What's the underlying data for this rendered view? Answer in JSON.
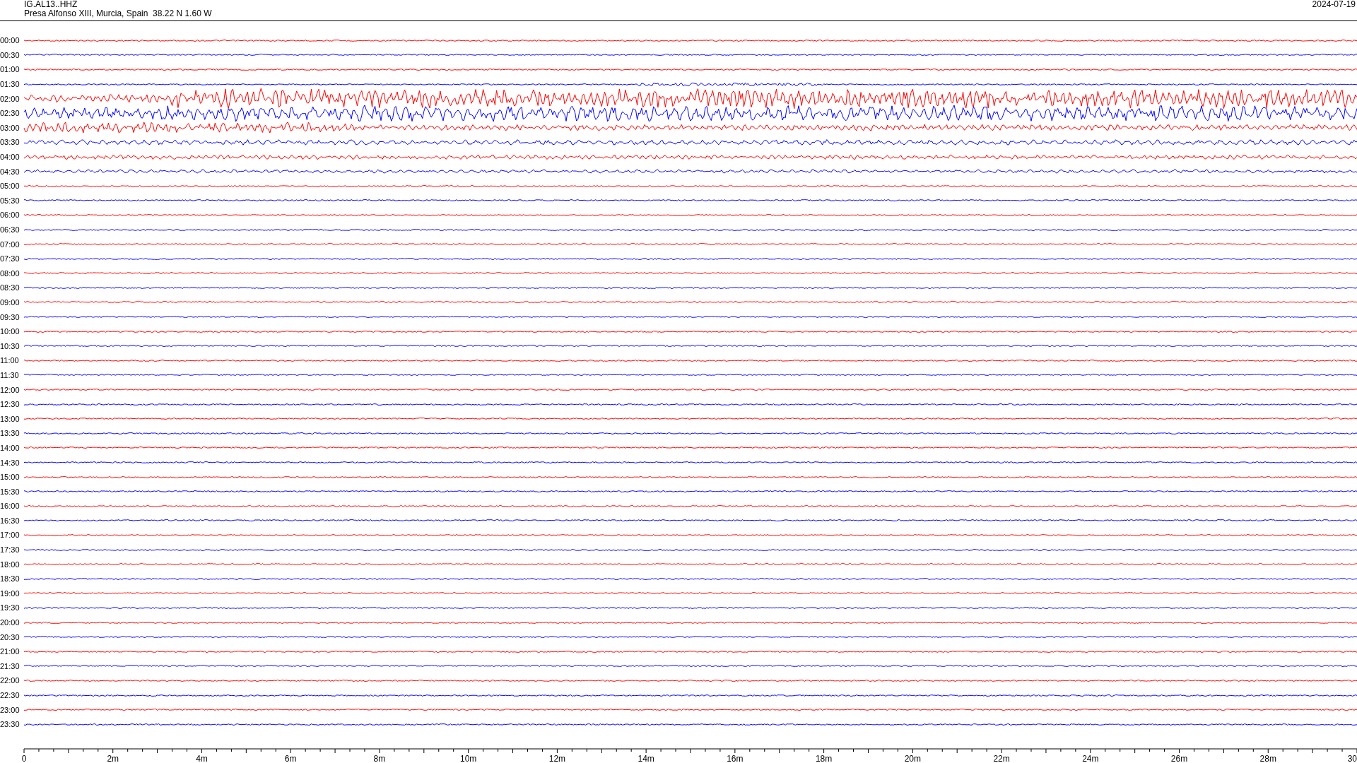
{
  "header": {
    "station": "IG.AL13..HHZ",
    "location": "Presa Alfonso XIII, Murcia, Spain  38.22 N 1.60 W",
    "date": "2024-07-19"
  },
  "traces": [
    {
      "time": "00:00",
      "color": "#ff0000"
    },
    {
      "time": "00:30",
      "color": "#0000ff"
    },
    {
      "time": "01:00",
      "color": "#ff0000"
    },
    {
      "time": "01:30",
      "color": "#0000ff"
    },
    {
      "time": "02:00",
      "color": "#ff0000"
    },
    {
      "time": "02:30",
      "color": "#0000ff"
    },
    {
      "time": "03:00",
      "color": "#ff0000"
    },
    {
      "time": "03:30",
      "color": "#0000ff"
    },
    {
      "time": "04:00",
      "color": "#ff0000"
    },
    {
      "time": "04:30",
      "color": "#0000ff"
    },
    {
      "time": "05:00",
      "color": "#ff0000"
    },
    {
      "time": "05:30",
      "color": "#0000ff"
    },
    {
      "time": "06:00",
      "color": "#ff0000"
    },
    {
      "time": "06:30",
      "color": "#0000ff"
    },
    {
      "time": "07:00",
      "color": "#ff0000"
    },
    {
      "time": "07:30",
      "color": "#0000ff"
    },
    {
      "time": "08:00",
      "color": "#ff0000"
    },
    {
      "time": "08:30",
      "color": "#0000ff"
    },
    {
      "time": "09:00",
      "color": "#ff0000"
    },
    {
      "time": "09:30",
      "color": "#0000ff"
    },
    {
      "time": "10:00",
      "color": "#ff0000"
    },
    {
      "time": "10:30",
      "color": "#0000ff"
    },
    {
      "time": "11:00",
      "color": "#ff0000"
    },
    {
      "time": "11:30",
      "color": "#0000ff"
    },
    {
      "time": "12:00",
      "color": "#ff0000"
    },
    {
      "time": "12:30",
      "color": "#0000ff"
    },
    {
      "time": "13:00",
      "color": "#ff0000"
    },
    {
      "time": "13:30",
      "color": "#0000ff"
    },
    {
      "time": "14:00",
      "color": "#ff0000"
    },
    {
      "time": "14:30",
      "color": "#0000ff"
    },
    {
      "time": "15:00",
      "color": "#ff0000"
    },
    {
      "time": "15:30",
      "color": "#0000ff"
    },
    {
      "time": "16:00",
      "color": "#ff0000"
    },
    {
      "time": "16:30",
      "color": "#0000ff"
    },
    {
      "time": "17:00",
      "color": "#ff0000"
    },
    {
      "time": "17:30",
      "color": "#0000ff"
    },
    {
      "time": "18:00",
      "color": "#ff0000"
    },
    {
      "time": "18:30",
      "color": "#0000ff"
    },
    {
      "time": "19:00",
      "color": "#ff0000"
    },
    {
      "time": "19:30",
      "color": "#0000ff"
    },
    {
      "time": "20:00",
      "color": "#ff0000"
    },
    {
      "time": "20:30",
      "color": "#0000ff"
    },
    {
      "time": "21:00",
      "color": "#ff0000"
    },
    {
      "time": "21:30",
      "color": "#0000ff"
    },
    {
      "time": "22:00",
      "color": "#ff0000"
    },
    {
      "time": "22:30",
      "color": "#0000ff"
    },
    {
      "time": "23:00",
      "color": "#ff0000"
    },
    {
      "time": "23:30",
      "color": "#0000ff"
    }
  ],
  "x_axis": {
    "ticks": [
      "0",
      "2m",
      "4m",
      "6m",
      "8m",
      "10m",
      "12m",
      "14m",
      "16m",
      "18m",
      "20m",
      "22m",
      "24m",
      "26m",
      "28m",
      "30"
    ]
  }
}
